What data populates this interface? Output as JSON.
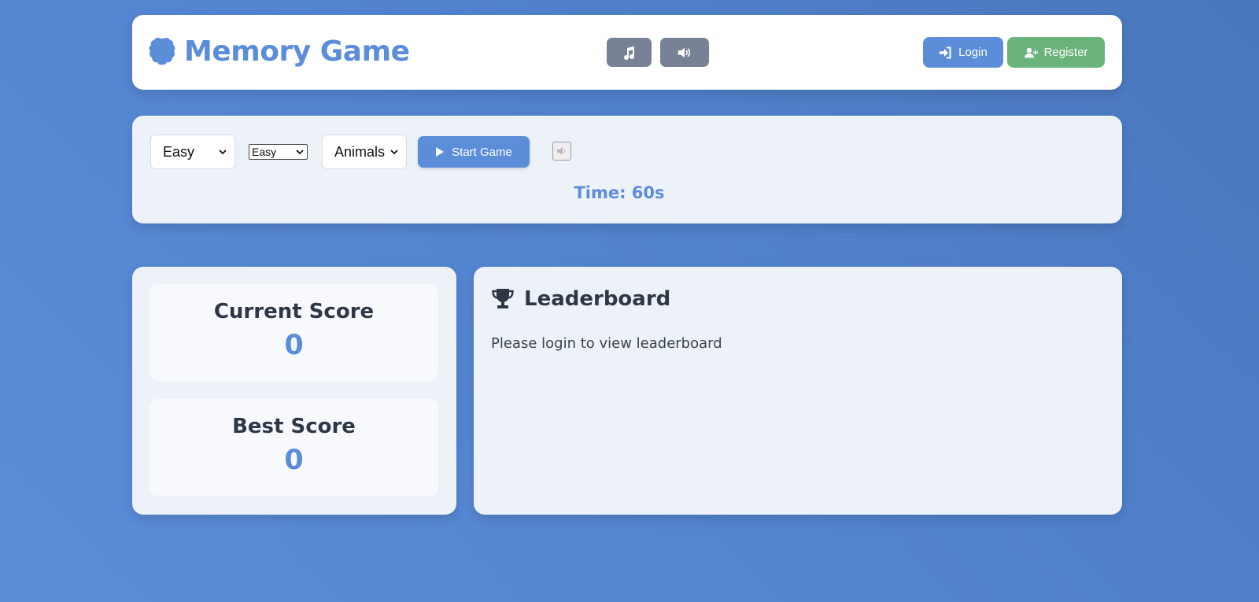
{
  "header": {
    "title": "Memory Game",
    "logo_icon": "brain-icon",
    "music_icon": "music-icon",
    "sound_icon": "volume-icon",
    "login_label": "Login",
    "register_label": "Register"
  },
  "controls": {
    "difficulty_select": {
      "selected": "Easy"
    },
    "difficulty_select_small": {
      "selected": "Easy"
    },
    "theme_select": {
      "selected": "Animals"
    },
    "start_label": "Start Game",
    "timer": "Time: 60s"
  },
  "scores": {
    "current_label": "Current Score",
    "current_value": "0",
    "best_label": "Best Score",
    "best_value": "0"
  },
  "leaderboard": {
    "title": "Leaderboard",
    "message": "Please login to view leaderboard"
  },
  "colors": {
    "accent": "#5b8dd8",
    "success": "#6ab37a",
    "muted_button": "#778394",
    "text_dark": "#2e3745"
  }
}
